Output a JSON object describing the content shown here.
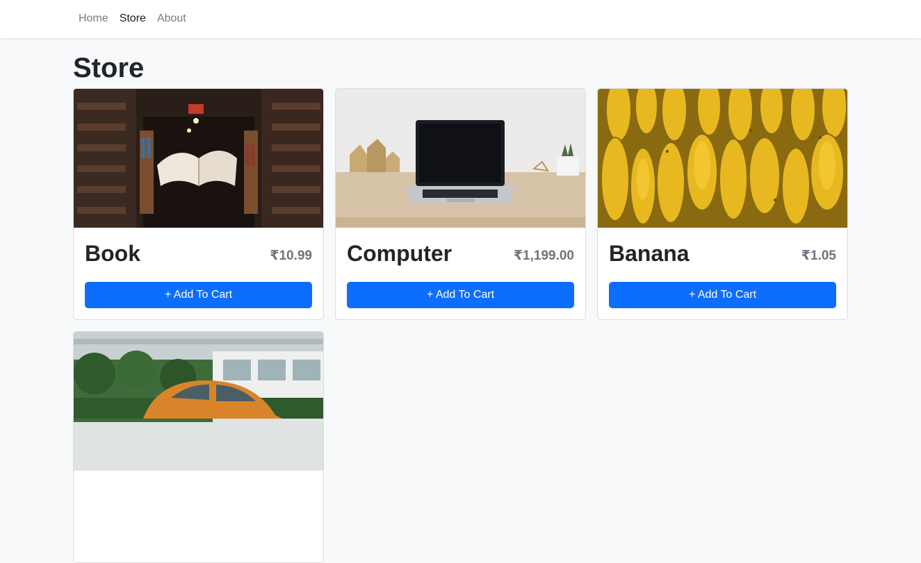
{
  "nav": {
    "links": [
      {
        "label": "Home"
      },
      {
        "label": "Store"
      },
      {
        "label": "About"
      }
    ]
  },
  "page": {
    "title": "Store"
  },
  "products": [
    {
      "name": "Book",
      "price": "₹10.99",
      "button": "+ Add To Cart",
      "image": "library-book-image"
    },
    {
      "name": "Computer",
      "price": "₹1,199.00",
      "button": "+ Add To Cart",
      "image": "laptop-desk-image"
    },
    {
      "name": "Banana",
      "price": "₹1.05",
      "button": "+ Add To Cart",
      "image": "bananas-image"
    },
    {
      "name": "",
      "price": "",
      "button": "",
      "image": "orange-car-image"
    }
  ],
  "colors": {
    "primary": "#0d6efd",
    "page_bg": "#f8f9fa",
    "price": "#6c757d"
  }
}
